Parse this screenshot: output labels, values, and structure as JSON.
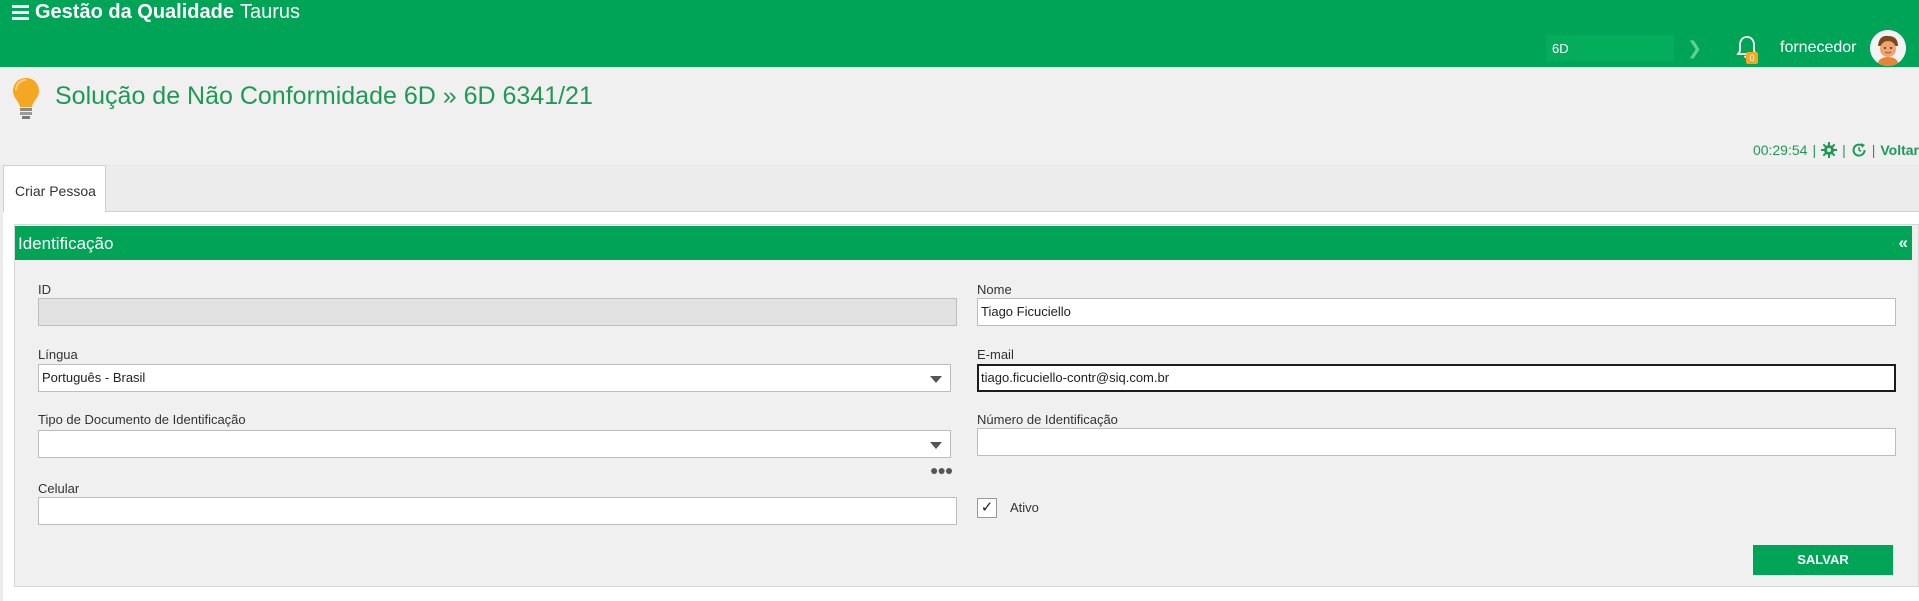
{
  "app": {
    "title_bold": "Gestão da Qualidade",
    "title_light": "Taurus"
  },
  "header": {
    "search_value": "6D",
    "notification_count": "0",
    "username": "fornecedor"
  },
  "page": {
    "title": "Solução de Não Conformidade 6D » 6D 6341/21"
  },
  "toolbar": {
    "timer": "00:29:54",
    "back_label": "Voltar"
  },
  "tabs": [
    {
      "label": "Criar Pessoa"
    }
  ],
  "section": {
    "title": "Identificação",
    "collapse_glyph": "«"
  },
  "form": {
    "id": {
      "label": "ID",
      "value": ""
    },
    "nome": {
      "label": "Nome",
      "value": "Tiago Ficuciello"
    },
    "lingua": {
      "label": "Língua",
      "value": "Português - Brasil"
    },
    "email": {
      "label": "E-mail",
      "value": "tiago.ficuciello-contr@siq.com.br"
    },
    "tipo_doc": {
      "label": "Tipo de Documento de Identificação",
      "value": ""
    },
    "numero_id": {
      "label": "Número de Identificação",
      "value": ""
    },
    "celular": {
      "label": "Celular",
      "value": ""
    },
    "ativo": {
      "label": "Ativo",
      "checked": true,
      "glyph": "✓"
    }
  },
  "actions": {
    "save_label": "SALVAR"
  },
  "icons": {
    "menu": "hamburger-icon",
    "search_go": "chevron-right-icon",
    "bell": "bell-icon",
    "avatar": "avatar-icon",
    "page": "lightbulb-icon",
    "settings": "gear-icon",
    "refresh": "refresh-clock-icon"
  },
  "colors": {
    "brand_green": "#00a457",
    "title_green": "#1f9a55",
    "badge_orange": "#f5a623"
  }
}
